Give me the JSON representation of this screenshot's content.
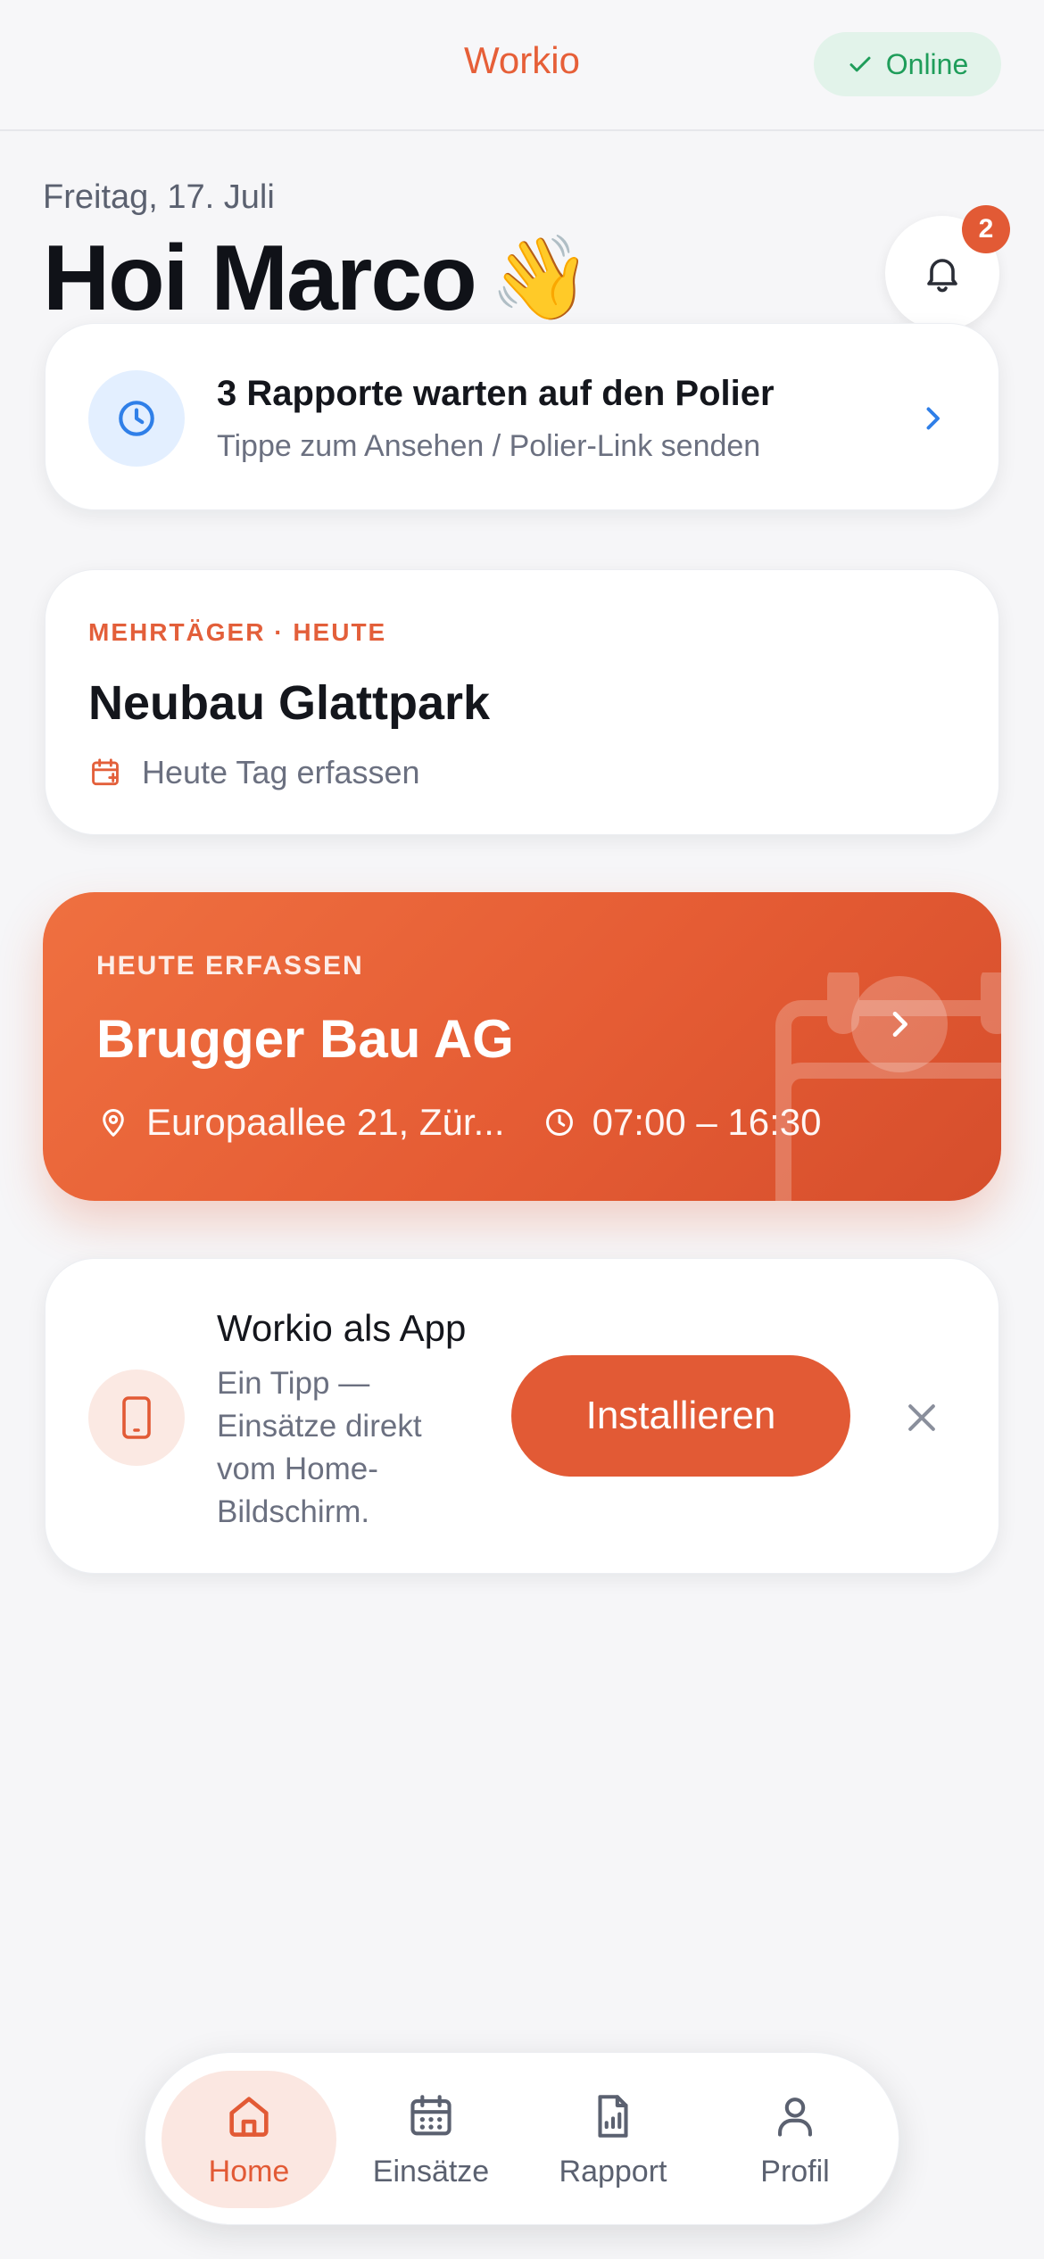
{
  "topbar": {
    "title": "Workio",
    "status": {
      "label": "Online",
      "icon": "check-icon",
      "color": "#1f9d5a"
    }
  },
  "header": {
    "date": "Freitag, 17. Juli",
    "greeting": "Hoi Marco",
    "emoji": "👋",
    "notifications": {
      "icon": "bell-icon",
      "count": "2"
    }
  },
  "pending_card": {
    "icon": "clock-icon",
    "title": "3 Rapporte warten auf den Polier",
    "subtitle": "Tippe zum Ansehen / Polier-Link senden"
  },
  "project_card": {
    "kicker": "MEHRTÄGER · HEUTE",
    "title": "Neubau Glattpark",
    "action": "Heute Tag erfassen",
    "action_icon": "calendar-plus-icon"
  },
  "job_card": {
    "kicker": "HEUTE ERFASSEN",
    "title": "Brugger Bau AG",
    "address": "Europaallee 21, Zür...",
    "time": "07:00 – 16:30",
    "accent": "#e55c34"
  },
  "install_card": {
    "icon": "phone-icon",
    "title": "Workio als App",
    "description": "Ein Tipp — Einsätze direkt vom Home-Bildschirm.",
    "button": "Installieren"
  },
  "bottom_nav": {
    "items": [
      {
        "label": "Home",
        "icon": "home-icon",
        "active": true
      },
      {
        "label": "Einsätze",
        "icon": "calendar-icon",
        "active": false
      },
      {
        "label": "Rapport",
        "icon": "report-icon",
        "active": false
      },
      {
        "label": "Profil",
        "icon": "user-icon",
        "active": false
      }
    ]
  },
  "colors": {
    "brand": "#e25a35",
    "info": "#2f7fe8",
    "success": "#1f9d5a"
  }
}
